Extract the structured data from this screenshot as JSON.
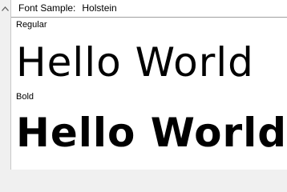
{
  "header": {
    "label": "Font Sample:",
    "font_name": "Holstein"
  },
  "samples": [
    {
      "style": "Regular",
      "text": "Hello World"
    },
    {
      "style": "Bold",
      "text": "Hello World"
    }
  ],
  "icons": {
    "scroll_up": "chevron-up-icon"
  }
}
